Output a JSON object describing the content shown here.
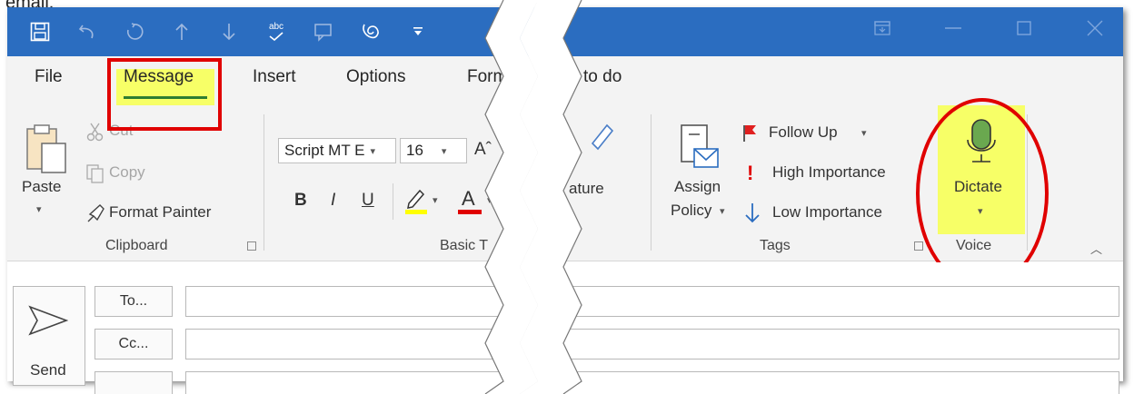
{
  "above_text": "email.",
  "quick_access": {
    "save_icon": "save-icon",
    "undo_icon": "undo-icon",
    "redo_icon": "redo-icon",
    "up_icon": "arrow-up-icon",
    "down_icon": "arrow-down-icon",
    "spelling_label": "abc",
    "customize_icon": "dropdown-icon"
  },
  "tabs": [
    "File",
    "Message",
    "Insert",
    "Options",
    "Form",
    "to do"
  ],
  "active_tab": "Message",
  "clipboard": {
    "paste": "Paste",
    "cut": "Cut",
    "copy": "Copy",
    "format_painter": "Format Painter",
    "group_name": "Clipboard"
  },
  "basic_text": {
    "font_name": "Script MT E",
    "font_size": "16",
    "bold": "B",
    "italic": "I",
    "underline": "U",
    "font_color": "A",
    "group_name": "Basic T"
  },
  "signature": {
    "label": "ature"
  },
  "tags": {
    "assign_policy_1": "Assign",
    "assign_policy_2": "Policy",
    "follow_up": "Follow Up",
    "high_importance": "High Importance",
    "low_importance": "Low Importance",
    "group_name": "Tags"
  },
  "voice": {
    "dictate": "Dictate",
    "group_name": "Voice"
  },
  "compose": {
    "send": "Send",
    "to": "To...",
    "cc": "Cc..."
  },
  "colors": {
    "titlebar": "#2b6dc0",
    "ribbon": "#f3f3f3",
    "highlight": "#f7ff67",
    "callout": "#e00000",
    "mic": "#6aa84f"
  }
}
